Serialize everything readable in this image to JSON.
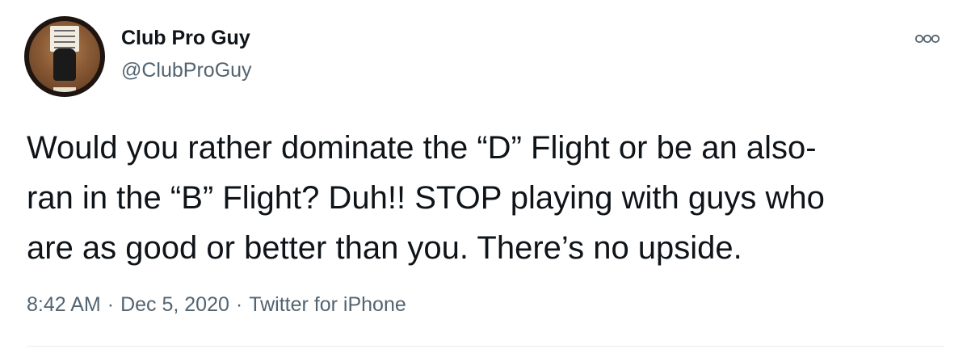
{
  "author": {
    "display_name": "Club Pro Guy",
    "handle": "@ClubProGuy",
    "avatar_icon": "profile-photo-icon"
  },
  "tweet": {
    "text": "Would you rather dominate the “D” Flight or be an also-\nran in the “B” Flight? Duh!! STOP playing with guys who\nare as good or better than you. There’s no upside."
  },
  "meta": {
    "time": "8:42 AM",
    "separator": "·",
    "date": "Dec 5, 2020",
    "source": "Twitter for iPhone"
  },
  "icons": {
    "more": "more-options-icon"
  },
  "colors": {
    "text": "#0f1419",
    "secondary": "#536471",
    "divider": "#e6ecf0"
  }
}
